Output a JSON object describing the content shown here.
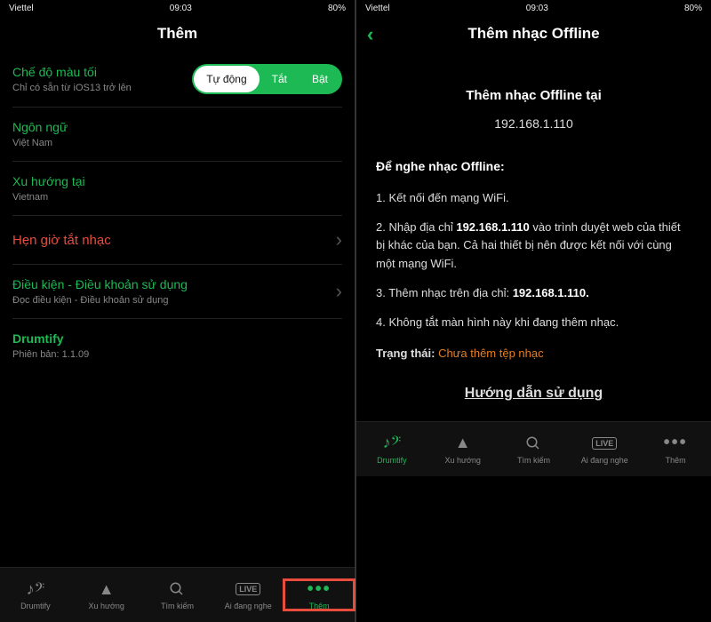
{
  "statusbar": {
    "carrier": "Viettel",
    "time": "09:03",
    "battery": "80%"
  },
  "left": {
    "title": "Thêm",
    "darkmode": {
      "label": "Chế độ màu tối",
      "sub": "Chỉ có sẵn từ iOS13 trở lên"
    },
    "seg": {
      "auto": "Tự động",
      "off": "Tắt",
      "on": "Bật"
    },
    "lang": {
      "label": "Ngôn ngữ",
      "value": "Việt Nam"
    },
    "trend": {
      "label": "Xu hướng tại",
      "value": "Vietnam"
    },
    "sleep": {
      "label": "Hẹn giờ tắt nhạc"
    },
    "terms": {
      "label": "Điều kiện - Điều khoản sử dụng",
      "sub": "Đọc điều kiện - Điều khoản sử dụng"
    },
    "app": {
      "name": "Drumtify",
      "version": "Phiên bản: 1.1.09"
    }
  },
  "right": {
    "title": "Thêm nhạc Offline",
    "subtitle": "Thêm nhạc Offline tại",
    "ip": "192.168.1.110",
    "heading": "Để nghe nhạc Offline:",
    "step1": "1. Kết nối đến mạng WiFi.",
    "step2_a": "2. Nhập địa chỉ ",
    "step2_ip": "192.168.1.110",
    "step2_b": " vào trình duyệt web của thiết bị khác của bạn. Cả hai thiết bị nên được kết nối với cùng một mạng WiFi.",
    "step3_a": "3. Thêm nhạc trên địa chỉ: ",
    "step3_ip": "192.168.1.110.",
    "step4": "4. Không tắt màn hình này khi đang thêm nhạc.",
    "status_label": "Trạng thái: ",
    "status_value": "Chưa thêm tệp nhạc",
    "guide": "Hướng dẫn sử dụng"
  },
  "tabs": {
    "drumtify": "Drumtify",
    "trending": "Xu hướng",
    "search": "Tìm kiếm",
    "listening": "Ai đang nghe",
    "more": "Thêm",
    "live": "LIVE"
  }
}
